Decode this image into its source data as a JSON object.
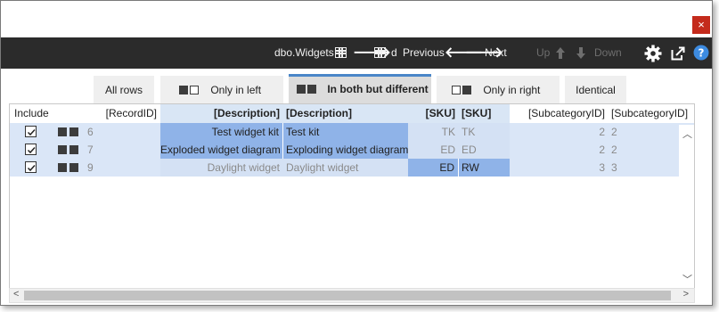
{
  "window": {
    "close_label": "×"
  },
  "toolbar": {
    "left_table": "dbo.Widgets",
    "right_table": "d",
    "previous": "Previous",
    "next": "Next",
    "up": "Up",
    "down": "Down"
  },
  "tabs": [
    {
      "label": "All rows",
      "active": false
    },
    {
      "label": "Only in left",
      "active": false
    },
    {
      "label": "In both but different",
      "active": true
    },
    {
      "label": "Only in right",
      "active": false
    },
    {
      "label": "Identical",
      "active": false
    }
  ],
  "grid": {
    "headers": {
      "include": "Include",
      "record_id": "[RecordID]",
      "description_left": "[Description]",
      "description_right": "[Description]",
      "sku_left": "[SKU]",
      "sku_right": "[SKU]",
      "subcat_left": "[SubcategoryID]",
      "subcat_right": "[SubcategoryID]"
    },
    "rows": [
      {
        "included": true,
        "record_id": "6",
        "desc_left": "Test widget kit",
        "desc_right": "Test kit",
        "sku_left": "TK",
        "sku_right": "TK",
        "subcat_left": "2",
        "subcat_right": "2",
        "desc_diff": true,
        "sku_diff": false
      },
      {
        "included": true,
        "record_id": "7",
        "desc_left": "Exploded widget diagram",
        "desc_right": "Exploding widget diagram",
        "sku_left": "ED",
        "sku_right": "ED",
        "subcat_left": "2",
        "subcat_right": "2",
        "desc_diff": true,
        "sku_diff": false
      },
      {
        "included": true,
        "record_id": "9",
        "desc_left": "Daylight widget",
        "desc_right": "Daylight widget",
        "sku_left": "ED",
        "sku_right": "RW",
        "subcat_left": "3",
        "subcat_right": "3",
        "desc_diff": false,
        "sku_diff": true
      }
    ]
  },
  "colors": {
    "toolbar_bg": "#2b2b2b",
    "diff_highlight": "#8fb3e8",
    "row_bg": "#dae6f7",
    "active_tab_accent": "#4a86c8",
    "close_button": "#c42b1c"
  },
  "icons": [
    "close-icon",
    "table-icon",
    "right-arrow-icon",
    "left-arrow-icon",
    "up-arrow-icon",
    "down-arrow-icon",
    "gear-icon",
    "export-icon",
    "help-icon",
    "checkbox-checked-icon"
  ]
}
